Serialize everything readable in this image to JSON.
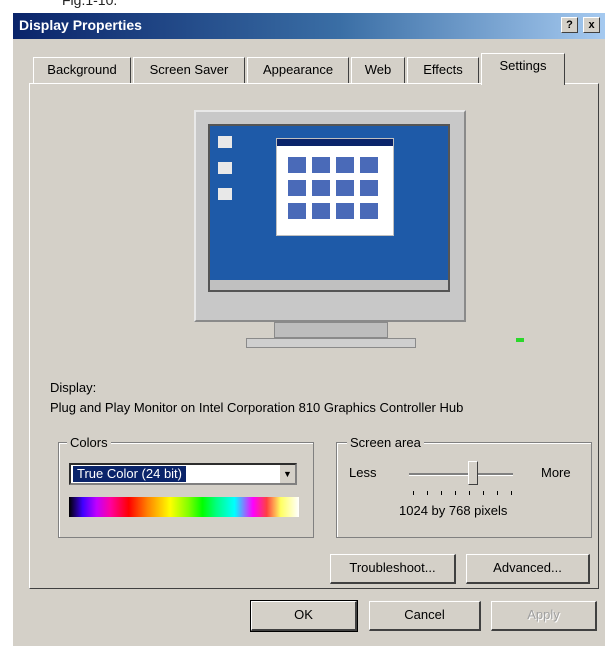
{
  "caption": "Fig.1-10.",
  "window": {
    "title": "Display Properties",
    "help_label": "?",
    "close_label": "x"
  },
  "tabs": [
    "Background",
    "Screen Saver",
    "Appearance",
    "Web",
    "Effects",
    "Settings"
  ],
  "active_tab": "Settings",
  "display": {
    "label": "Display:",
    "value": "Plug and Play Monitor on Intel Corporation 810 Graphics Controller Hub"
  },
  "colors": {
    "legend": "Colors",
    "selected": "True Color (24 bit)"
  },
  "screen_area": {
    "legend": "Screen area",
    "less_label": "Less",
    "more_label": "More",
    "resolution": "1024 by 768 pixels",
    "slider_position": 0.62
  },
  "buttons": {
    "troubleshoot": "Troubleshoot...",
    "advanced": "Advanced...",
    "ok": "OK",
    "cancel": "Cancel",
    "apply": "Apply"
  },
  "colors_theme": {
    "titlebar_start": "#0a246a",
    "face": "#d4d0c8",
    "desktop": "#1e5aa8"
  }
}
